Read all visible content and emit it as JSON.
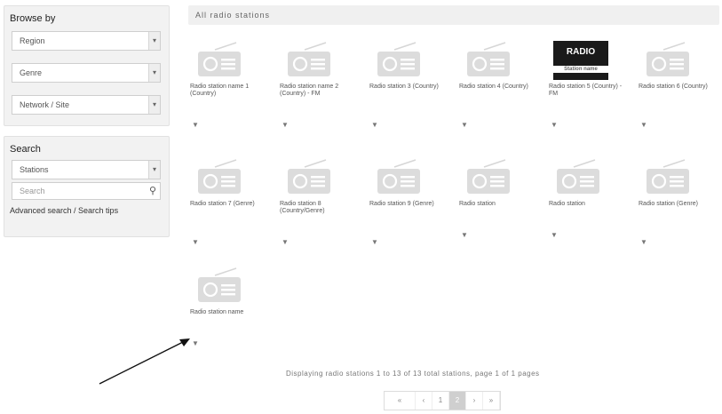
{
  "browse": {
    "title": "Browse by",
    "selects": [
      "Region",
      "Genre",
      "Network / Site"
    ]
  },
  "search": {
    "title": "Search",
    "select": "Stations",
    "placeholder": "Search",
    "advanced_link": "Advanced search / Search tips",
    "search_icon": "search-icon"
  },
  "header": {
    "title": "All radio stations"
  },
  "stations": [
    {
      "name": "Radio station name 1 (Country)",
      "logo": false
    },
    {
      "name": "Radio station name 2 (Country) - FM",
      "logo": false
    },
    {
      "name": "Radio station 3 (Country)",
      "logo": false
    },
    {
      "name": "Radio station 4 (Country)",
      "logo": false
    },
    {
      "name": "Radio station 5 (Country) - FM",
      "logo": true,
      "logo_text": "RADIO",
      "logo_sub": "Station name"
    },
    {
      "name": "Radio station 6 (Country)",
      "logo": false
    },
    {
      "name": "Radio station 7 (Genre)",
      "logo": false
    },
    {
      "name": "Radio station 8 (Country/Genre)",
      "logo": false
    },
    {
      "name": "Radio station 9 (Genre)",
      "logo": false
    },
    {
      "name": "Radio station",
      "logo": false
    },
    {
      "name": "Radio station",
      "logo": false
    },
    {
      "name": "Radio station (Genre)",
      "logo": false
    },
    {
      "name": "Radio station name",
      "logo": false
    }
  ],
  "pager": {
    "summary": "Displaying radio stations 1 to 13 of 13 total stations, page 1 of 1 pages",
    "items": [
      "«",
      "‹",
      "1",
      "2",
      "›",
      "»"
    ],
    "active_index": 3
  }
}
